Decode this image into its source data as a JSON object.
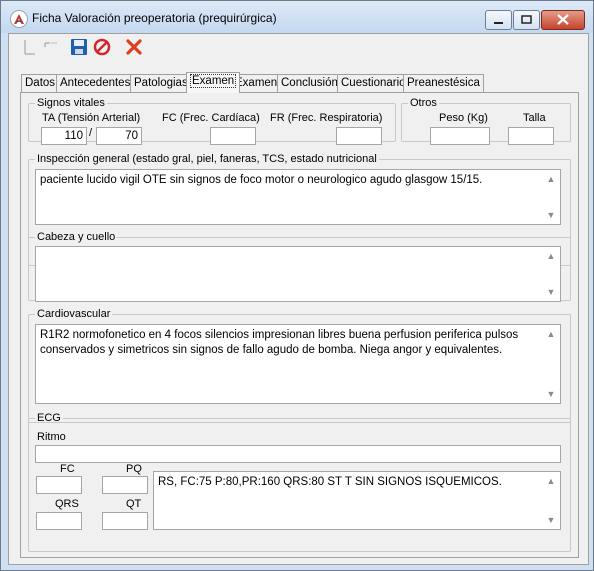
{
  "window": {
    "title": "Ficha Valoración preoperatoria (prequirúrgica)"
  },
  "tabs": [
    "Datos",
    "Antecedentes",
    "Patologias",
    "Examen",
    "Examen",
    "Conclusión",
    "Cuestionario",
    "Preanestésica"
  ],
  "active_tab_index": 3,
  "signos_vitales": {
    "legend": "Signos vitales",
    "ta_label": "TA (Tensión Arterial)",
    "ta_separator": "/",
    "ta_systolic": "110",
    "ta_diastolic": "70",
    "fc_label": "FC (Frec. Cardíaca)",
    "fc_value": "",
    "fr_label": "FR  (Frec. Respiratoria)",
    "fr_value": ""
  },
  "otros": {
    "legend": "Otros",
    "peso_label": "Peso (Kg)",
    "peso_value": "",
    "talla_label": "Talla",
    "talla_value": ""
  },
  "inspeccion": {
    "legend": "Inspección general (estado gral, piel, faneras, TCS, estado nutricional",
    "text": "paciente lucido vigil OTE sin signos de foco motor o neurologico agudo glasgow 15/15."
  },
  "cabeza": {
    "legend": "Cabeza y cuello",
    "text": ""
  },
  "cardio": {
    "legend": "Cardiovascular",
    "text": "R1R2 normofonetico en 4 focos silencios impresionan libres buena perfusion periferica pulsos conservados y simetricos sin signos de fallo agudo de bomba. Niega angor y equivalentes."
  },
  "ecg": {
    "legend": "ECG",
    "ritmo_label": "Ritmo",
    "ritmo_value": "",
    "fc_label": "FC",
    "fc_value": "",
    "pq_label": "PQ",
    "pq_value": "",
    "qrs_label": "QRS",
    "qrs_value": "",
    "qt_label": "QT",
    "qt_value": "",
    "text": "RS, FC:75 P:80,PR:160 QRS:80 ST T SIN SIGNOS ISQUEMICOS."
  },
  "icons": {
    "app": "app-logo-icon",
    "new": "new-icon",
    "open": "open-icon",
    "save": "save-icon",
    "cancel": "cancel-icon",
    "delete": "delete-icon"
  },
  "colors": {
    "titlebar": "#c4d8f0",
    "close_button": "#c4432b",
    "delete_icon": "#e03c1e"
  }
}
